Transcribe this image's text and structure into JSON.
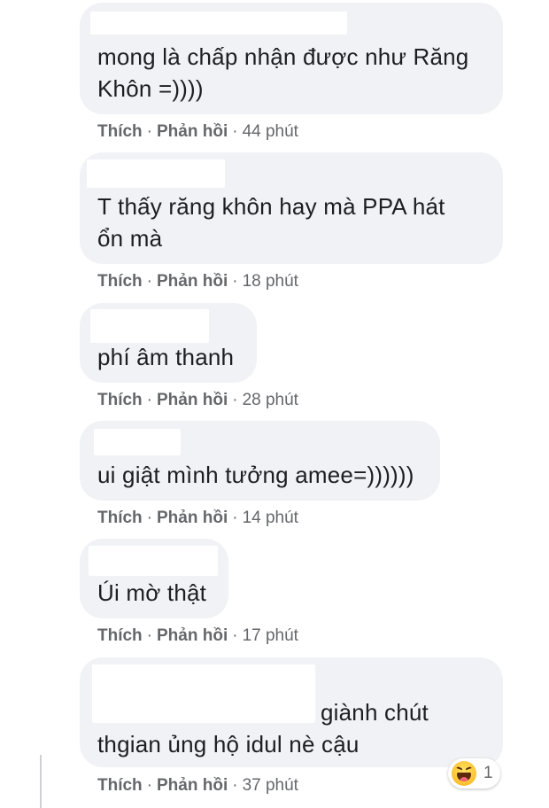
{
  "actions": {
    "like": "Thích",
    "reply": "Phản hồi",
    "separator": "·"
  },
  "comments": [
    {
      "text": "mong là chấp nhận được như Răng\nKhôn =))))",
      "time": "44 phút"
    },
    {
      "text": "T thấy răng khôn hay mà PPA hát\nổn mà",
      "time": "18 phút"
    },
    {
      "text": "phí âm thanh",
      "time": "28 phút"
    },
    {
      "text": "ui giật mình tưởng amee=))))))",
      "time": "14 phút"
    },
    {
      "text": "Úi mờ thật",
      "time": "17 phút"
    },
    {
      "text": "giành chút\nthgian ủng hộ idul nè cậu",
      "time": "37 phút"
    }
  ],
  "reaction": {
    "icon": "haha-emoji-icon",
    "count": "1"
  },
  "colors": {
    "bubble": "#f0f2f5",
    "meta_text": "#65676b",
    "body_text": "#1c1e21"
  }
}
